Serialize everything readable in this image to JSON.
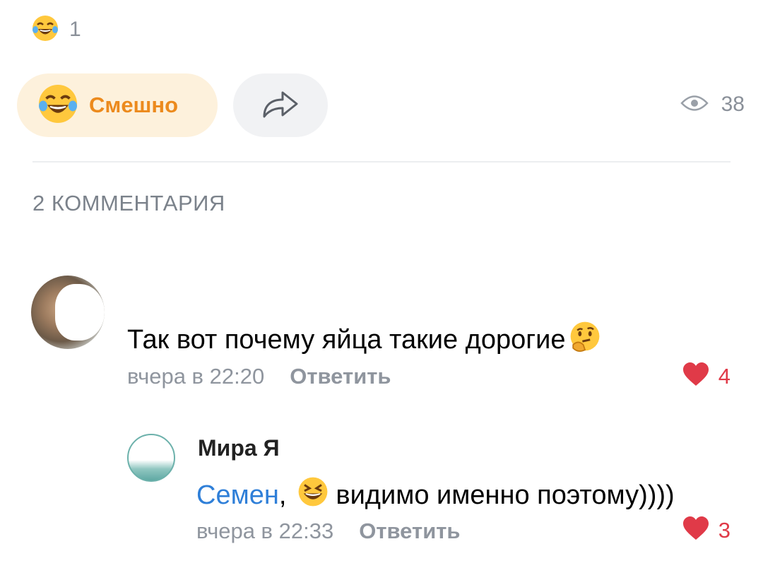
{
  "reactions": {
    "emoji_icon": "tears-of-joy-icon",
    "count": "1"
  },
  "actions": {
    "react_label": "Смешно",
    "share_icon": "share-arrow-icon",
    "views_count": "38",
    "accent": "#ec8a1d"
  },
  "comments_header": "2 КОММЕНТАРИЯ",
  "comments": [
    {
      "text": "Так вот почему яйца такие дорогие",
      "emoji": "thinking-face-icon",
      "time": "вчера в 22:20",
      "reply_label": "Ответить",
      "likes": "4"
    }
  ],
  "reply": {
    "author": "Мира Я",
    "mention": "Семен",
    "separator": ",",
    "emoji": "grinning-squinting-face-icon",
    "text": "видимо именно поэтому))))",
    "time": "вчера в 22:33",
    "reply_label": "Ответить",
    "likes": "3"
  },
  "colors": {
    "like": "#e03a48",
    "mention": "#2f7fd8",
    "meta": "#8f959e"
  }
}
